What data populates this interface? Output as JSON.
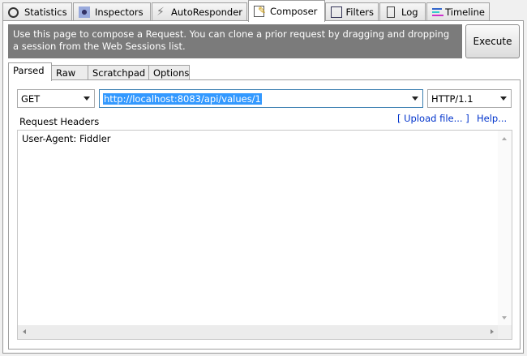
{
  "tabs": [
    {
      "label": "Statistics",
      "icon": "stopwatch-icon"
    },
    {
      "label": "Inspectors",
      "icon": "inspectors-icon"
    },
    {
      "label": "AutoResponder",
      "icon": "lightning-icon"
    },
    {
      "label": "Composer",
      "icon": "pencil-note-icon",
      "selected": true
    },
    {
      "label": "Filters",
      "icon": "checkbox-icon"
    },
    {
      "label": "Log",
      "icon": "document-icon"
    },
    {
      "label": "Timeline",
      "icon": "timeline-icon"
    }
  ],
  "info": "Use this page to compose a Request. You can clone a prior request by dragging and dropping a session from the Web Sessions list.",
  "execute": "Execute",
  "subtabs": [
    "Parsed",
    "Raw",
    "Scratchpad",
    "Options"
  ],
  "method": "GET",
  "url": "http://localhost:8083/api/values/1",
  "version": "HTTP/1.1",
  "headers_label": "Request Headers",
  "upload": "[ Upload file... ]",
  "help": "Help...",
  "headers_text": "User-Agent: Fiddler"
}
